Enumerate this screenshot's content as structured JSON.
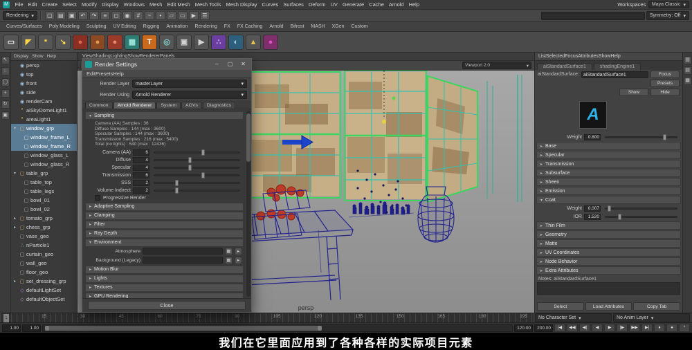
{
  "subtitle": "我们在它里面应用到了各种各样的实际项目元素",
  "menubar": {
    "logo_glyph": "M",
    "items": [
      "File",
      "Edit",
      "Create",
      "Select",
      "Modify",
      "Display",
      "Windows",
      "Mesh",
      "Edit Mesh",
      "Mesh Tools",
      "Mesh Display",
      "Curves",
      "Surfaces",
      "Deform",
      "UV",
      "Generate",
      "Cache",
      "Arnold",
      "Help"
    ],
    "workspace_label": "Workspaces",
    "workspace_value": "Maya Classic",
    "workspace_arrow": "▾"
  },
  "statusline": {
    "menuset": "Rendering",
    "menuset_arrow": "▾",
    "icons": [
      {
        "name": "new-scene-icon",
        "glyph": "▢"
      },
      {
        "name": "open-scene-icon",
        "glyph": "▤"
      },
      {
        "name": "save-scene-icon",
        "glyph": "▣"
      },
      {
        "name": "undo-icon",
        "glyph": "↶"
      },
      {
        "name": "redo-icon",
        "glyph": "↷"
      },
      {
        "name": "select-hierarchy-icon",
        "glyph": "≡"
      },
      {
        "name": "select-object-icon",
        "glyph": "◻"
      },
      {
        "name": "select-component-icon",
        "glyph": "◉"
      },
      {
        "name": "snap-to-grid-icon",
        "glyph": "#"
      },
      {
        "name": "snap-to-curve-icon",
        "glyph": "~"
      },
      {
        "name": "snap-to-point-icon",
        "glyph": "•"
      },
      {
        "name": "snap-to-plane-icon",
        "glyph": "▱"
      },
      {
        "name": "render-view-icon",
        "glyph": "▭"
      },
      {
        "name": "ipr-render-icon",
        "glyph": "▶"
      },
      {
        "name": "render-settings-icon",
        "glyph": "☰"
      }
    ],
    "field_value": "",
    "dropdown_value": "Symmetry: Off",
    "dropdown_arrow": "▾"
  },
  "shelf": {
    "tabs": [
      "Curves/Surfaces",
      "Poly Modeling",
      "Sculpting",
      "UV Editing",
      "Rigging",
      "Animation",
      "Rendering",
      "FX",
      "FX Caching",
      "Arnold",
      "Bifrost",
      "MASH",
      "XGen",
      "Custom"
    ],
    "icons": [
      {
        "name": "area-light-icon",
        "glyph": "▭",
        "bg": "#565656",
        "fg": "#e8e8e8"
      },
      {
        "name": "spot-light-icon",
        "glyph": "◤",
        "bg": "#565656",
        "fg": "#ffd54a"
      },
      {
        "name": "point-light-icon",
        "glyph": "*",
        "bg": "#565656",
        "fg": "#ffd54a"
      },
      {
        "name": "directional-light-icon",
        "glyph": "↘",
        "bg": "#565656",
        "fg": "#ffd54a"
      },
      {
        "name": "standard-surface-icon",
        "glyph": "●",
        "bg": "#8a2f23",
        "fg": "#e8694f"
      },
      {
        "name": "lambert-material-icon",
        "glyph": "●",
        "bg": "#8a4a23",
        "fg": "#e89a4f"
      },
      {
        "name": "blinn-material-icon",
        "glyph": "●",
        "bg": "#9a3a2a",
        "fg": "#f08a6a"
      },
      {
        "name": "checker-texture-icon",
        "glyph": "▦",
        "bg": "#2e7d74",
        "fg": "#9fe8dd"
      },
      {
        "name": "paint-3d-tool-icon",
        "glyph": "T",
        "bg": "#c96a1e",
        "fg": "#ffffff"
      },
      {
        "name": "hypershade-icon",
        "glyph": "◎",
        "bg": "#565656",
        "fg": "#7fd0c8"
      },
      {
        "name": "render-current-frame-icon",
        "glyph": "▣",
        "bg": "#565656",
        "fg": "#d2d2d2"
      },
      {
        "name": "ipr-shelf-icon",
        "glyph": "▶",
        "bg": "#565656",
        "fg": "#d2d2d2"
      },
      {
        "name": "shader-ball-set-icon",
        "glyph": "∴",
        "bg": "#6b3fa0",
        "fg": "#d0b3f5"
      },
      {
        "name": "env-dome-icon",
        "glyph": "◐",
        "bg": "#2e5f7d",
        "fg": "#9fd4e8"
      },
      {
        "name": "cone-light-icon",
        "glyph": "▲",
        "bg": "#565656",
        "fg": "#e8c34f"
      },
      {
        "name": "texture-sphere-icon",
        "glyph": "●",
        "bg": "#7d2e6b",
        "fg": "#e84fc1"
      }
    ]
  },
  "toolbox": {
    "icons": [
      {
        "name": "select-tool-icon",
        "glyph": "↖"
      },
      {
        "name": "lasso-tool-icon",
        "glyph": "◌"
      },
      {
        "name": "paint-select-tool-icon",
        "glyph": "◯"
      },
      {
        "name": "move-tool-icon",
        "glyph": "+"
      },
      {
        "name": "rotate-tool-icon",
        "glyph": "↻"
      },
      {
        "name": "scale-tool-icon",
        "glyph": "▣"
      }
    ]
  },
  "outliner": {
    "menus": [
      "Display",
      "Show",
      "Help"
    ],
    "items": [
      {
        "name": "persp",
        "glyph": "◉",
        "color": "#9fc3e0",
        "arrow": ""
      },
      {
        "name": "top",
        "glyph": "◉",
        "color": "#9fc3e0",
        "arrow": ""
      },
      {
        "name": "front",
        "glyph": "◉",
        "color": "#9fc3e0",
        "arrow": ""
      },
      {
        "name": "side",
        "glyph": "◉",
        "color": "#9fc3e0",
        "arrow": ""
      },
      {
        "name": "renderCam",
        "glyph": "◉",
        "color": "#9fc3e0",
        "arrow": ""
      },
      {
        "name": "aiSkyDomeLight1",
        "glyph": "*",
        "color": "#e8d44a",
        "arrow": ""
      },
      {
        "name": "areaLight1",
        "glyph": "*",
        "color": "#e8d44a",
        "arrow": ""
      },
      {
        "name": "window_grp",
        "glyph": "▢",
        "color": "#d8a86a",
        "arrow": "▾",
        "selected": true
      },
      {
        "name": "window_frame_L",
        "glyph": "▢",
        "color": "#e8e8e8",
        "arrow": "",
        "pad": 10,
        "selected": true
      },
      {
        "name": "window_frame_R",
        "glyph": "▢",
        "color": "#e8e8e8",
        "arrow": "",
        "pad": 10,
        "selected": true
      },
      {
        "name": "window_glass_L",
        "glyph": "▢",
        "color": "#b8b8b8",
        "arrow": "",
        "pad": 10
      },
      {
        "name": "window_glass_R",
        "glyph": "▢",
        "color": "#b8b8b8",
        "arrow": "",
        "pad": 10
      },
      {
        "name": "table_grp",
        "glyph": "▢",
        "color": "#d8a86a",
        "arrow": "▾"
      },
      {
        "name": "table_top",
        "glyph": "▢",
        "color": "#b8b8b8",
        "arrow": "",
        "pad": 10
      },
      {
        "name": "table_legs",
        "glyph": "▢",
        "color": "#b8b8b8",
        "arrow": "",
        "pad": 10
      },
      {
        "name": "bowl_01",
        "glyph": "▢",
        "color": "#b8b8b8",
        "arrow": "",
        "pad": 10
      },
      {
        "name": "bowl_02",
        "glyph": "▢",
        "color": "#b8b8b8",
        "arrow": "",
        "pad": 10
      },
      {
        "name": "tomato_grp",
        "glyph": "▢",
        "color": "#d8a86a",
        "arrow": "▸"
      },
      {
        "name": "chess_grp",
        "glyph": "▢",
        "color": "#d8a86a",
        "arrow": "▸"
      },
      {
        "name": "vase_geo",
        "glyph": "▢",
        "color": "#b8b8b8",
        "arrow": ""
      },
      {
        "name": "nParticle1",
        "glyph": "∴",
        "color": "#7fd0c8",
        "arrow": ""
      },
      {
        "name": "curtain_geo",
        "glyph": "▢",
        "color": "#b8b8b8",
        "arrow": ""
      },
      {
        "name": "wall_geo",
        "glyph": "▢",
        "color": "#b8b8b8",
        "arrow": ""
      },
      {
        "name": "floor_geo",
        "glyph": "▢",
        "color": "#b8b8b8",
        "arrow": ""
      },
      {
        "name": "set_dressing_grp",
        "glyph": "▢",
        "color": "#d8a86a",
        "arrow": "▸"
      },
      {
        "name": "defaultLightSet",
        "glyph": "◇",
        "color": "#c08ad8",
        "arrow": ""
      },
      {
        "name": "defaultObjectSet",
        "glyph": "◇",
        "color": "#c08ad8",
        "arrow": ""
      }
    ]
  },
  "viewport": {
    "menus": [
      "View",
      "Shading",
      "Lighting",
      "Show",
      "Renderer",
      "Panels"
    ],
    "icons": [
      {
        "name": "select-camera-icon",
        "glyph": "▦"
      },
      {
        "name": "lock-camera-icon",
        "glyph": "▣"
      },
      {
        "name": "camera-attributes-icon",
        "glyph": "≡"
      },
      {
        "name": "bookmark-icon",
        "glyph": "▾"
      },
      {
        "name": "image-plane-icon",
        "glyph": "▭"
      },
      {
        "name": "2d-pan-zoom-icon",
        "glyph": "↔"
      },
      {
        "name": "grid-toggle-icon",
        "glyph": "#"
      },
      {
        "name": "film-gate-icon",
        "glyph": "▢"
      },
      {
        "name": "resolution-gate-icon",
        "glyph": "◻"
      },
      {
        "name": "gate-mask-icon",
        "glyph": "▥"
      },
      {
        "name": "safe-action-icon",
        "glyph": "+"
      },
      {
        "name": "wireframe-mode-icon",
        "glyph": "◇"
      },
      {
        "name": "shaded-mode-icon",
        "glyph": "●"
      },
      {
        "name": "textured-mode-icon",
        "glyph": "◎"
      }
    ],
    "dropdown_value": "Viewport 2.0",
    "dropdown_arrow": "▾",
    "hud_camera": "persp"
  },
  "dialog": {
    "title": "Render Settings",
    "controls": {
      "minimize": "–",
      "maximize": "▢",
      "close": "✕"
    },
    "menus": [
      "Edit",
      "Presets",
      "Help"
    ],
    "render_layer_label": "Render Layer",
    "render_layer_value": "masterLayer",
    "render_using_label": "Render Using",
    "render_using_value": "Arnold Renderer",
    "dd_arrow": "▾",
    "tabs": [
      {
        "label": "Common"
      },
      {
        "label": "Arnold Renderer",
        "active": true
      },
      {
        "label": "System"
      },
      {
        "label": "AOVs"
      },
      {
        "label": "Diagnostics"
      }
    ],
    "sampling": {
      "arrow": "▾",
      "title": "Sampling",
      "info_lines": [
        {
          "text": "Camera (AA) Samples : 36"
        },
        {
          "text": "Diffuse Samples : 144 (max : 3600)"
        },
        {
          "text": "Specular Samples : 144 (max : 3600)"
        },
        {
          "text": "Transmission Samples : 216 (max : 5400)"
        },
        {
          "text": "Total (no lights) : 540 (max : 12436)"
        }
      ],
      "sliders": [
        {
          "label": "Camera (AA)",
          "value": "6",
          "pos": 55
        },
        {
          "label": "Diffuse",
          "value": "4",
          "pos": 40
        },
        {
          "label": "Specular",
          "value": "4",
          "pos": 40
        },
        {
          "label": "Transmission",
          "value": "6",
          "pos": 55
        },
        {
          "label": "SSS",
          "value": "2",
          "pos": 25
        },
        {
          "label": "Volume Indirect",
          "value": "2",
          "pos": 25
        }
      ],
      "checkbox_label": "Progressive Render"
    },
    "sections_a": [
      {
        "arrow": "▸",
        "label": "Adaptive Sampling"
      },
      {
        "arrow": "▸",
        "label": "Clamping"
      },
      {
        "arrow": "▸",
        "label": "Filter"
      },
      {
        "arrow": "▸",
        "label": "Ray Depth"
      }
    ],
    "environment": {
      "arrow": "▾",
      "title": "Environment",
      "rows": [
        {
          "label": "Atmosphere",
          "map_glyph": "▦",
          "menu_glyph": "▸"
        },
        {
          "label": "Background (Legacy)",
          "map_glyph": "▦",
          "menu_glyph": "▸"
        }
      ]
    },
    "sections_b": [
      {
        "arrow": "▸",
        "label": "Motion Blur"
      },
      {
        "arrow": "▸",
        "label": "Lights"
      },
      {
        "arrow": "▸",
        "label": "Textures"
      },
      {
        "arrow": "▸",
        "label": "GPU Rendering"
      }
    ],
    "close_label": "Close"
  },
  "attribute_editor": {
    "menus": [
      "List",
      "Selected",
      "Focus",
      "Attributes",
      "Show",
      "Help"
    ],
    "tabs": [
      {
        "label": "aiStandardSurface1",
        "active": true
      },
      {
        "label": "shadingEngine1"
      }
    ],
    "name_label": "aiStandardSurface:",
    "name_value": "aiStandardSurface1",
    "focus_label": "Focus",
    "presets_label": "Presets",
    "show_label": "Show",
    "hide_label": "Hide",
    "swatch_letter": "A",
    "weight_row": {
      "label": "Weight",
      "value": "0.800",
      "pos": 80
    },
    "sections_a": [
      {
        "arrow": "▸",
        "label": "Base"
      },
      {
        "arrow": "▸",
        "label": "Specular"
      },
      {
        "arrow": "▸",
        "label": "Transmission"
      },
      {
        "arrow": "▸",
        "label": "Subsurface"
      },
      {
        "arrow": "▸",
        "label": "Sheen"
      },
      {
        "arrow": "▸",
        "label": "Emission"
      }
    ],
    "expanded": {
      "arrow": "▾",
      "title": "Coat",
      "rows": [
        {
          "label": "Weight",
          "value": "0.007",
          "pos": 4
        },
        {
          "label": "IOR",
          "value": "1.520",
          "pos": 18
        }
      ]
    },
    "sections_b": [
      {
        "arrow": "▸",
        "label": "Thin Film"
      },
      {
        "arrow": "▸",
        "label": "Geometry"
      },
      {
        "arrow": "▸",
        "label": "Matte"
      },
      {
        "arrow": "▸",
        "label": "UV Coordinates"
      },
      {
        "arrow": "▸",
        "label": "Node Behavior"
      },
      {
        "arrow": "▸",
        "label": "Extra Attributes"
      }
    ],
    "notes_label": "Notes: aiStandardSurface1",
    "footer_buttons": [
      {
        "name": "select-button",
        "label": "Select"
      },
      {
        "name": "load-attributes-button",
        "label": "Load Attributes"
      },
      {
        "name": "copy-tab-button",
        "label": "Copy Tab"
      }
    ]
  },
  "right_strip": {
    "icons": [
      {
        "name": "attribute-editor-tab-icon",
        "glyph": "▥"
      },
      {
        "name": "tool-settings-tab-icon",
        "glyph": "▤"
      },
      {
        "name": "channel-box-tab-icon",
        "glyph": "▦"
      }
    ]
  },
  "timeline": {
    "tick_labels": [
      {
        "t": "1"
      },
      {
        "t": "15"
      },
      {
        "t": "30"
      },
      {
        "t": "45"
      },
      {
        "t": "60"
      },
      {
        "t": "75"
      },
      {
        "t": "90"
      },
      {
        "t": "105"
      },
      {
        "t": "120"
      },
      {
        "t": "135"
      },
      {
        "t": "150"
      },
      {
        "t": "165"
      },
      {
        "t": "180"
      },
      {
        "t": "195"
      }
    ],
    "current_frame": "1",
    "character_set": "No Character Set",
    "anim_layer": "No Anim Layer",
    "dd_arrow": "▾",
    "range_start_min": "1.00",
    "range_start": "1.00",
    "range_end": "120.00",
    "range_end_max": "200.00",
    "playback_icons": [
      {
        "name": "go-to-start-icon",
        "glyph": "|◀"
      },
      {
        "name": "step-back-frame-icon",
        "glyph": "◀◀"
      },
      {
        "name": "step-back-key-icon",
        "glyph": "◀|"
      },
      {
        "name": "play-backwards-icon",
        "glyph": "◀"
      },
      {
        "name": "play-forwards-icon",
        "glyph": "▶"
      },
      {
        "name": "step-forward-key-icon",
        "glyph": "|▶"
      },
      {
        "name": "step-forward-frame-icon",
        "glyph": "▶▶"
      },
      {
        "name": "go-to-end-icon",
        "glyph": "▶|"
      }
    ],
    "extra_icons": [
      {
        "name": "set-key-icon",
        "glyph": "♦"
      },
      {
        "name": "auto-key-icon",
        "glyph": "●"
      },
      {
        "name": "animation-preferences-icon",
        "glyph": "*"
      }
    ]
  },
  "colors": {
    "selection_green": "#3bd65e",
    "wire_teal": "#33c2b0",
    "wire_navy": "#23238f",
    "tomato_red": "#bb3a28",
    "arnold_blue": "#2fb3e8"
  }
}
